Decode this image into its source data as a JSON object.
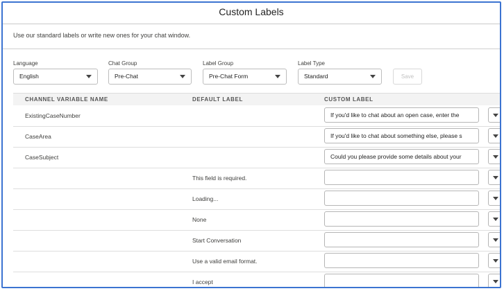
{
  "header": {
    "title": "Custom Labels"
  },
  "description": "Use our standard labels or write new ones for your chat window.",
  "filters": {
    "language": {
      "label": "Language",
      "value": "English"
    },
    "chat_group": {
      "label": "Chat Group",
      "value": "Pre-Chat"
    },
    "label_group": {
      "label": "Label Group",
      "value": "Pre-Chat Form"
    },
    "label_type": {
      "label": "Label Type",
      "value": "Standard"
    },
    "save_label": "Save"
  },
  "table": {
    "columns": [
      "CHANNEL VARIABLE NAME",
      "DEFAULT LABEL",
      "CUSTOM LABEL"
    ],
    "rows": [
      {
        "variable": "ExistingCaseNumber",
        "default": "",
        "custom": "If you'd like to chat about an open case, enter the"
      },
      {
        "variable": "CaseArea",
        "default": "",
        "custom": "If you'd like to chat about something else, please s"
      },
      {
        "variable": "CaseSubject",
        "default": "",
        "custom": "Could you please provide some details about your"
      },
      {
        "variable": "",
        "default": "This field is required.",
        "custom": ""
      },
      {
        "variable": "",
        "default": "Loading...",
        "custom": ""
      },
      {
        "variable": "",
        "default": "None",
        "custom": ""
      },
      {
        "variable": "",
        "default": "Start Conversation",
        "custom": ""
      },
      {
        "variable": "",
        "default": "Use a valid email format.",
        "custom": ""
      },
      {
        "variable": "",
        "default": "I accept",
        "custom": ""
      }
    ]
  },
  "colors": {
    "frame_border": "#3b73d1",
    "header_bg": "#f3f3f3"
  }
}
